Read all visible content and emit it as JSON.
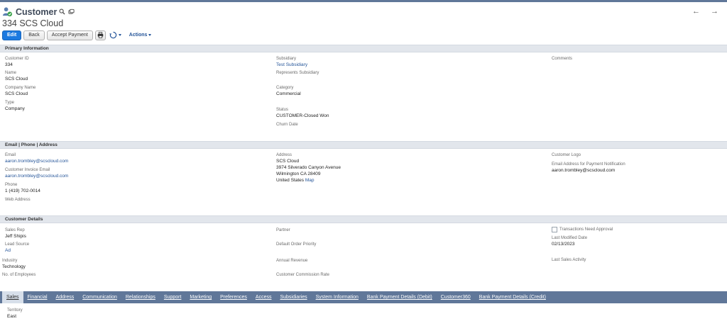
{
  "record": {
    "type": "Customer",
    "title": "334 SCS Cloud",
    "nav_arrows": "← →"
  },
  "toolbar": {
    "edit": "Edit",
    "back": "Back",
    "accept_payment": "Accept Payment",
    "actions": "Actions"
  },
  "sections": {
    "primary": "Primary Information",
    "email": "Email | Phone | Address",
    "details": "Customer Details"
  },
  "primary": {
    "customer_id_label": "Customer ID",
    "customer_id": "334",
    "name_label": "Name",
    "name": "SCS Cloud",
    "company_name_label": "Company Name",
    "company_name": "SCS Cloud",
    "type_label": "Type",
    "type": "Company",
    "subsidiary_label": "Subsidiary",
    "subsidiary": "Test Subsidiary",
    "represents_subsidiary_label": "Represents Subsidiary",
    "category_label": "Category",
    "category": "Commercial",
    "status_label": "Status",
    "status": "CUSTOMER-Closed Won",
    "churn_date_label": "Churn Date",
    "comments_label": "Comments"
  },
  "contact": {
    "email_label": "Email",
    "email": "aaron.trombley@scscloud.com",
    "invoice_email_label": "Customer Invoice Email",
    "invoice_email": "aaron.trombley@scscloud.com",
    "phone_label": "Phone",
    "phone": "1 (419) 702-0014",
    "web_label": "Web Address",
    "address_label": "Address",
    "address_line1": "SCS Cloud",
    "address_line2": "3974 Silverado Canyon Avenue",
    "address_line3": "Wilmington CA 28409",
    "address_line4": "United States",
    "map_link": "Map",
    "logo_label": "Customer Logo",
    "payment_notif_label": "Email Address for Payment Notification",
    "payment_notif": "aaron.trombley@scscloud.com"
  },
  "details": {
    "sales_rep_label": "Sales Rep",
    "sales_rep": "Jeff Shipis",
    "lead_source_label": "Lead Source",
    "lead_source": "Ad",
    "industry_label": "Industry",
    "industry": "Technology",
    "employees_label": "No. of Employees",
    "partner_label": "Partner",
    "order_priority_label": "Default Order Priority",
    "annual_revenue_label": "Annual Revenue",
    "commission_rate_label": "Customer Commission Rate",
    "txn_approval_label": "Transactions Need Approval",
    "last_modified_label": "Last Modified Date",
    "last_modified": "02/13/2023",
    "last_sales_label": "Last Sales Activity"
  },
  "tabs": [
    "Sales",
    "Financial",
    "Address",
    "Communication",
    "Relationships",
    "Support",
    "Marketing",
    "Preferences",
    "Access",
    "Subsidiaries",
    "System Information",
    "Bank Payment Details (Debit)",
    "Customer360",
    "Bank Payment Details (Credit)"
  ],
  "sales_tab": {
    "territory_label": "Territory",
    "territory": "East"
  },
  "colors": {
    "accent": "#607799",
    "primary_button": "#1d7ae0",
    "link": "#255599"
  }
}
